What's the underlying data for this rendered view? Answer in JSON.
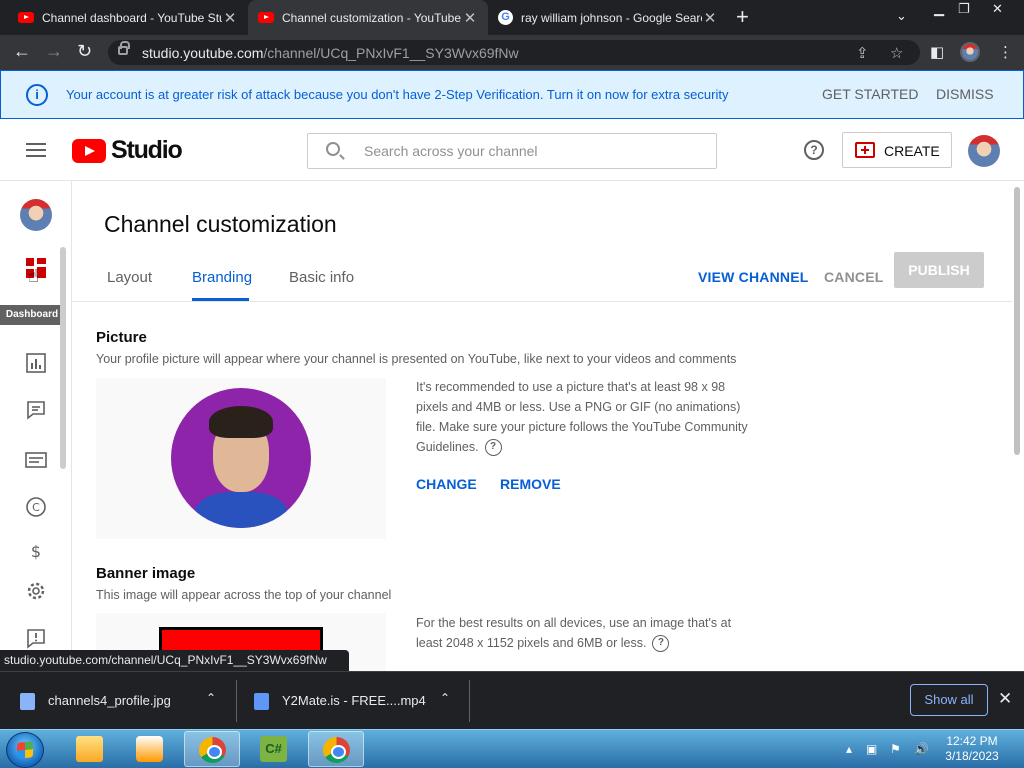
{
  "browser": {
    "tabs": [
      {
        "title": "Channel dashboard - YouTube Studio",
        "icon": "youtube-icon"
      },
      {
        "title": "Channel customization - YouTube Studio",
        "icon": "youtube-icon"
      },
      {
        "title": "ray william johnson - Google Search",
        "icon": "google-icon"
      }
    ],
    "url_host": "studio.youtube.com",
    "url_path": "/channel/UCq_PNxIvF1__SY3Wvx69fNw"
  },
  "security_banner": {
    "message": "Your account is at greater risk of attack because you don't have 2-Step Verification. Turn it on now for extra security",
    "get_started": "GET STARTED",
    "dismiss": "DISMISS"
  },
  "header": {
    "logo_text": "Studio",
    "search_placeholder": "Search across your channel",
    "create_label": "CREATE"
  },
  "leftnav": {
    "tooltip": "Dashboard",
    "items": [
      "dashboard",
      "analytics",
      "comments",
      "subtitles",
      "copyright",
      "earn",
      "settings",
      "feedback"
    ]
  },
  "page": {
    "title": "Channel customization",
    "tabs": [
      "Layout",
      "Branding",
      "Basic info"
    ],
    "active_tab": "Branding",
    "view_channel": "VIEW CHANNEL",
    "cancel": "CANCEL",
    "publish": "PUBLISH"
  },
  "picture": {
    "title": "Picture",
    "description": "Your profile picture will appear where your channel is presented on YouTube, like next to your videos and comments",
    "help": "It's recommended to use a picture that's at least 98 x 98 pixels and 4MB or less. Use a PNG or GIF (no animations) file. Make sure your picture follows the YouTube Community Guidelines.",
    "change": "CHANGE",
    "remove": "REMOVE"
  },
  "banner_image": {
    "title": "Banner image",
    "description": "This image will appear across the top of your channel",
    "help": "For the best results on all devices, use an image that's at least 2048 x 1152 pixels and 6MB or less."
  },
  "status_url": "studio.youtube.com/channel/UCq_PNxIvF1__SY3Wvx69fNw",
  "downloads": {
    "items": [
      "channels4_profile.jpg",
      "Y2Mate.is - FREE....mp4"
    ],
    "show_all": "Show all"
  },
  "taskbar": {
    "time": "12:42 PM",
    "date": "3/18/2023"
  },
  "colors": {
    "accent": "#065fd4",
    "brand_red": "#ff0000",
    "banner_bg": "#def1ff"
  }
}
